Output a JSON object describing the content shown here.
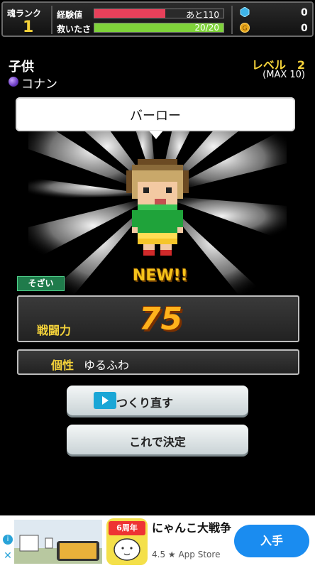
{
  "status_bar": {
    "rank_label": "魂ランク",
    "rank_value": "1",
    "exp_label": "経験値",
    "exp_text": "あと110",
    "exp_fraction": 0.55,
    "rescue_label": "救いたさ",
    "rescue_text": "20/20",
    "rescue_fraction": 1.0,
    "gem_count": "0",
    "coin_count": "0"
  },
  "header": {
    "category": "子供",
    "owner": "コナン",
    "level": "レベル　2",
    "level_max": "(MAX 10)"
  },
  "bubble": {
    "name": "バーロー"
  },
  "new_badge": "NEW!!",
  "material_tag": "そざい",
  "power": {
    "label": "戦闘力",
    "value": "75"
  },
  "trait": {
    "label": "個性",
    "value": "ゆるふわ"
  },
  "buttons": {
    "redo_label": "つくり直す",
    "confirm_label": "これで決定"
  },
  "ad": {
    "title": "にゃんこ大戦争",
    "rating_store": "4.5 ★ App Store",
    "install_label": "入手",
    "icon_badge": "6周年"
  },
  "colors": {
    "accent_yellow": "#f5d33a",
    "exp_bar": "#e8405a",
    "rescue_bar": "#7fd33a",
    "install_blue": "#1a8cf0"
  }
}
